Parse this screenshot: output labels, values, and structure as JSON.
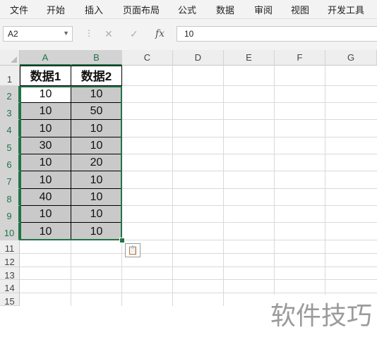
{
  "menu": [
    "文件",
    "开始",
    "插入",
    "页面布局",
    "公式",
    "数据",
    "审阅",
    "视图",
    "开发工具"
  ],
  "name_box": "A2",
  "formula_buttons": {
    "cancel": "✕",
    "enter": "✓",
    "fx": "fx"
  },
  "formula_value": "10",
  "columns": [
    "A",
    "B",
    "C",
    "D",
    "E",
    "F",
    "G"
  ],
  "rows": [
    "1",
    "2",
    "3",
    "4",
    "5",
    "6",
    "7",
    "8",
    "9",
    "10",
    "11",
    "12",
    "13",
    "14",
    "15"
  ],
  "table": {
    "headers": [
      "数据1",
      "数据2"
    ],
    "data": [
      [
        "10",
        "10"
      ],
      [
        "10",
        "50"
      ],
      [
        "10",
        "10"
      ],
      [
        "30",
        "10"
      ],
      [
        "10",
        "20"
      ],
      [
        "10",
        "10"
      ],
      [
        "40",
        "10"
      ],
      [
        "10",
        "10"
      ],
      [
        "10",
        "10"
      ]
    ]
  },
  "quick_analysis_icon": "clipboard-paste-icon",
  "watermark": "软件技巧"
}
